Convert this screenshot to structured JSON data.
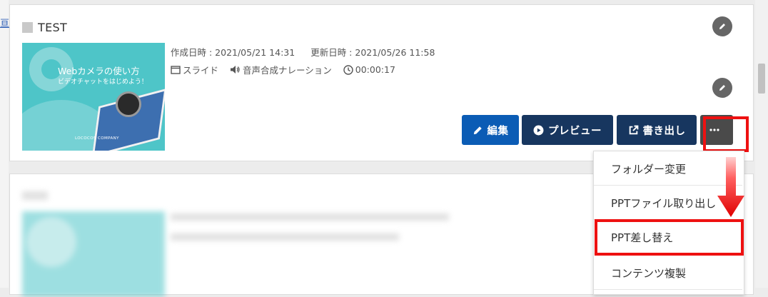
{
  "sidebar": {
    "link_text": "亘"
  },
  "content_item": {
    "title": "TEST",
    "thumbnail": {
      "heading": "Webカメラの使い方",
      "subheading": "ビデオチャットをはじめよう！",
      "brand": "LOCOCOS COMPANY"
    },
    "created": "作成日時 : 2021/05/21 14:31",
    "updated": "更新日時 : 2021/05/26 11:58",
    "type": "スライド",
    "narration": "音声合成ナレーション",
    "duration": "00:00:17",
    "buttons": {
      "edit": "編集",
      "preview": "プレビュー",
      "export": "書き出し"
    }
  },
  "menu": {
    "items": [
      "フォルダー変更",
      "PPTファイル取り出し",
      "PPT差し替え",
      "コンテンツ複製"
    ]
  },
  "colors": {
    "edit_button": "#0b5cb5",
    "dark_button": "#17365f",
    "more_button": "#4a4a4a",
    "highlight": "#ee1111",
    "thumb_bg": "#4ec5c8"
  }
}
